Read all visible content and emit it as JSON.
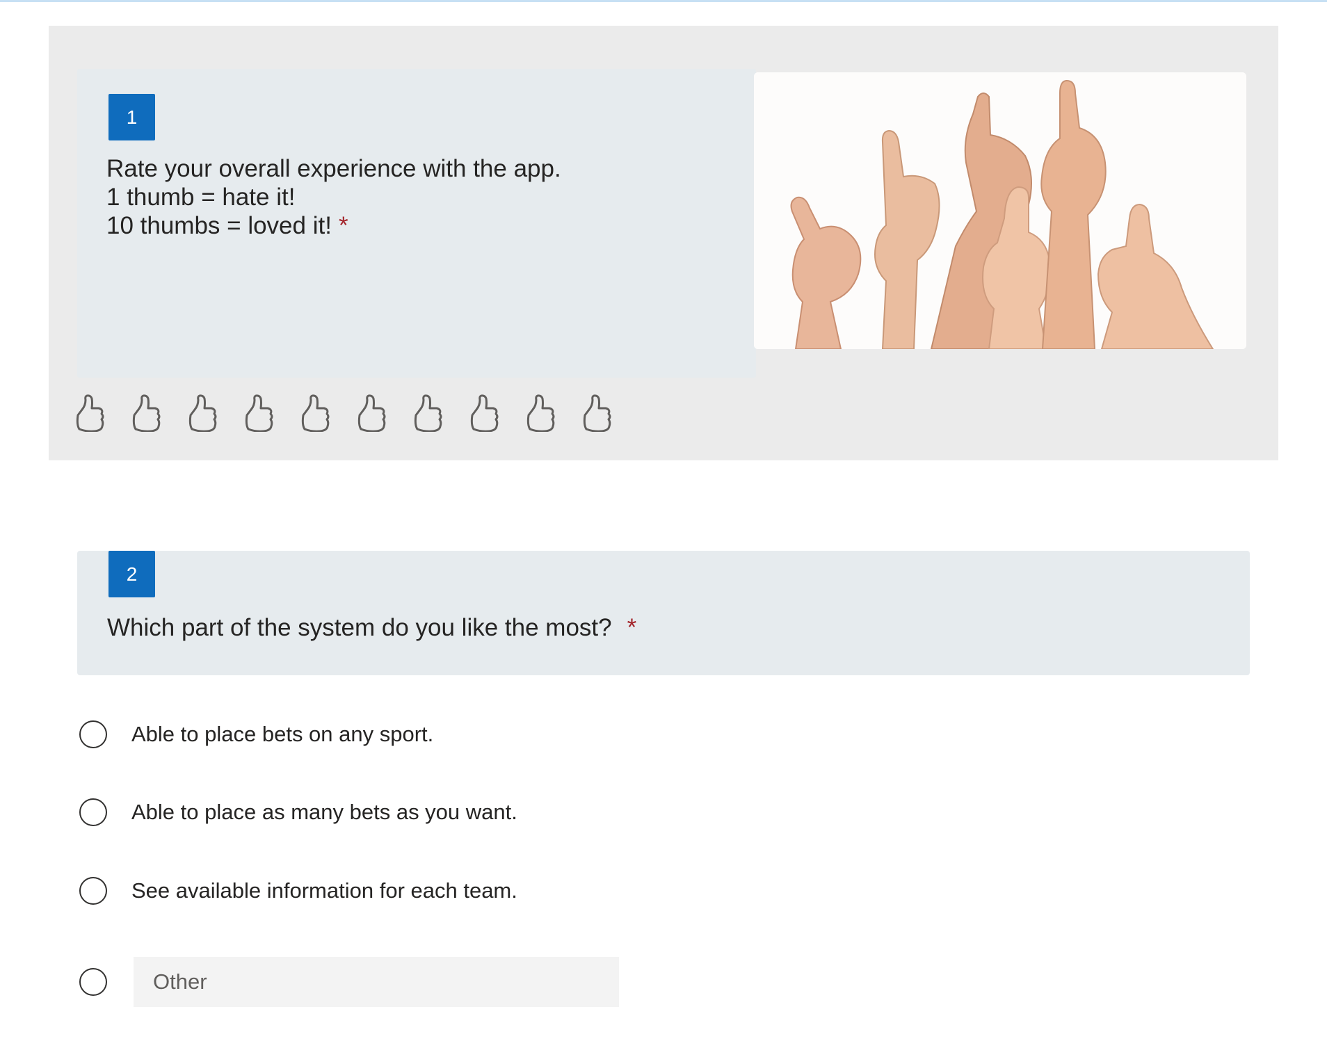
{
  "questions": [
    {
      "number": "1",
      "title_lines": [
        "Rate your overall experience with the app.",
        "1 thumb = hate it!",
        "10 thumbs = loved it!"
      ],
      "required_mark": "*",
      "image": "thumbs-up-hands-photo",
      "rating": {
        "max": 10,
        "selected": 0,
        "icon": "thumb-up-outline-icon"
      }
    },
    {
      "number": "2",
      "title": "Which part of the system do you like the most?",
      "required_mark": "*",
      "options": [
        "Able to place bets on any sport.",
        "Able to place as many bets as you want.",
        "See available information for each team."
      ],
      "other": {
        "placeholder": "Other",
        "value": ""
      }
    }
  ],
  "colors": {
    "accent": "#0f6cbd",
    "required": "#a4262c",
    "card_bg": "#ebebeb",
    "header_bg": "#e6ebee"
  }
}
